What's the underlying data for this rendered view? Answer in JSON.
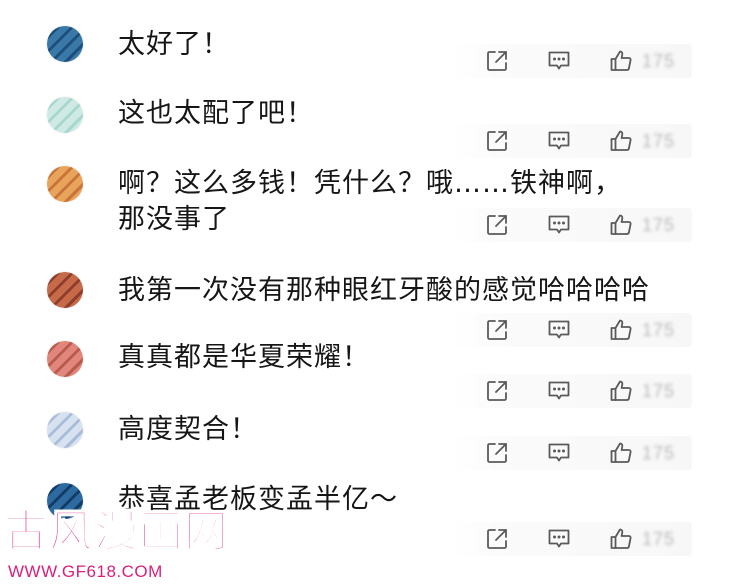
{
  "comments": [
    {
      "text": "太好了！",
      "likes": "175",
      "avatar_colors": [
        "#3a78a8",
        "#1d4f7c"
      ]
    },
    {
      "text": "这也太配了吧！",
      "likes": "175",
      "avatar_colors": [
        "#cfeae4",
        "#a8d8cd"
      ]
    },
    {
      "text": "啊？这么多钱！凭什么？哦……铁神啊，\n那没事了",
      "likes": "175",
      "avatar_colors": [
        "#e9a45c",
        "#c8743a"
      ]
    },
    {
      "text": "我第一次没有那种眼红牙酸的感觉哈哈哈哈",
      "likes": "175",
      "avatar_colors": [
        "#c76a4a",
        "#8e3f2c"
      ]
    },
    {
      "text": "真真都是华夏荣耀！",
      "likes": "175",
      "avatar_colors": [
        "#e0867a",
        "#b95a4f"
      ]
    },
    {
      "text": "高度契合！",
      "likes": "175",
      "avatar_colors": [
        "#d6e2f0",
        "#a9bdd8"
      ]
    },
    {
      "text": "恭喜孟老板变孟半亿～",
      "likes": "175",
      "avatar_colors": [
        "#2c6aa0",
        "#123b66"
      ]
    }
  ],
  "icons": {
    "share": "share-external-icon",
    "reply": "comment-bubble-icon",
    "like": "thumbs-up-icon"
  },
  "watermark": {
    "logo": "古风漫画网",
    "url": "WWW.GF618.COM",
    "color": "#d81f7b"
  }
}
